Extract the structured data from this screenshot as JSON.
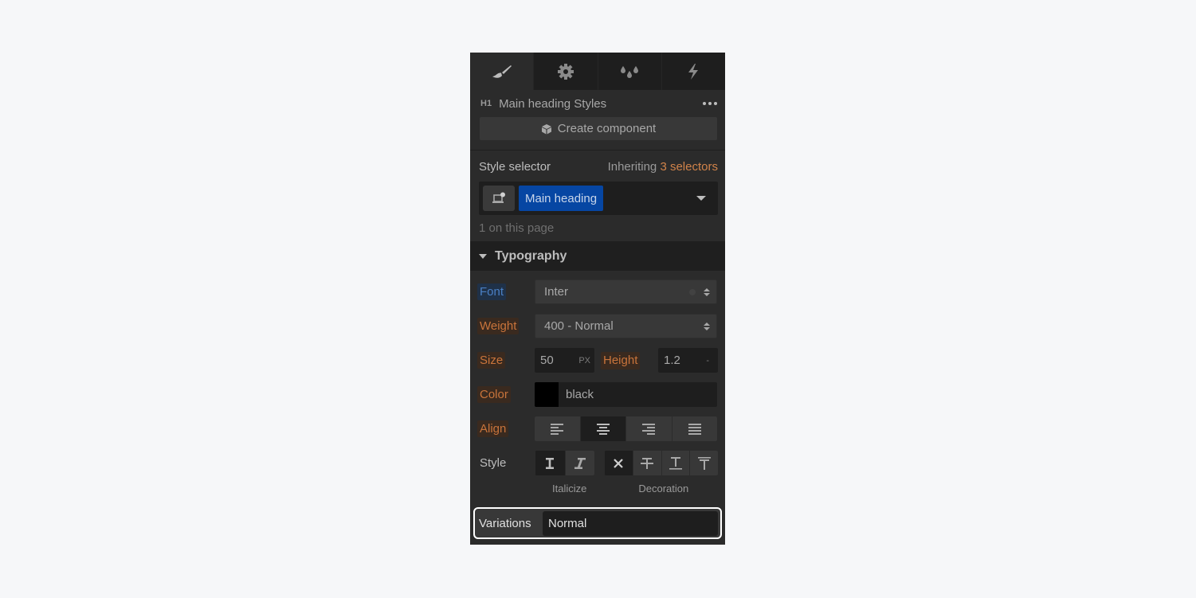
{
  "tabs": [
    {
      "name": "style",
      "icon": "paintbrush-icon",
      "active": true
    },
    {
      "name": "settings",
      "icon": "gear-icon",
      "active": false
    },
    {
      "name": "style-manager",
      "icon": "drops-icon",
      "active": false
    },
    {
      "name": "interactions",
      "icon": "lightning-icon",
      "active": false
    }
  ],
  "element": {
    "tag": "H1",
    "title": "Main heading Styles",
    "more_icon": "more-dots-icon"
  },
  "create_component": {
    "label": "Create component",
    "icon": "component-box-icon"
  },
  "selector": {
    "label": "Style selector",
    "inheriting_prefix": "Inheriting",
    "inheriting_count": "3 selectors",
    "chip": "Main heading",
    "on_page": "1 on this page",
    "colors": {
      "chip": "#0646a3",
      "inherit": "#d1834a"
    }
  },
  "typography": {
    "title": "Typography",
    "font": {
      "label": "Font",
      "value": "Inter"
    },
    "weight": {
      "label": "Weight",
      "value": "400 - Normal"
    },
    "size": {
      "label": "Size",
      "value": "50",
      "unit": "PX"
    },
    "height": {
      "label": "Height",
      "value": "1.2",
      "unit": "-"
    },
    "color": {
      "label": "Color",
      "value": "black",
      "swatch": "#000000"
    },
    "align": {
      "label": "Align",
      "options": [
        "left",
        "center",
        "right",
        "justify"
      ],
      "selected": "center"
    },
    "style": {
      "label": "Style",
      "italicize_label": "Italicize",
      "decoration_label": "Decoration",
      "italic_options": [
        "regular",
        "italic"
      ],
      "italic_selected": "regular",
      "decoration_options": [
        "none",
        "strikethrough",
        "underline",
        "overline"
      ],
      "decoration_selected": "none"
    },
    "variations": {
      "label": "Variations",
      "value": "Normal"
    }
  },
  "label_colors": {
    "set_here": "#4a7fc4",
    "inherited": "#c9743b"
  }
}
